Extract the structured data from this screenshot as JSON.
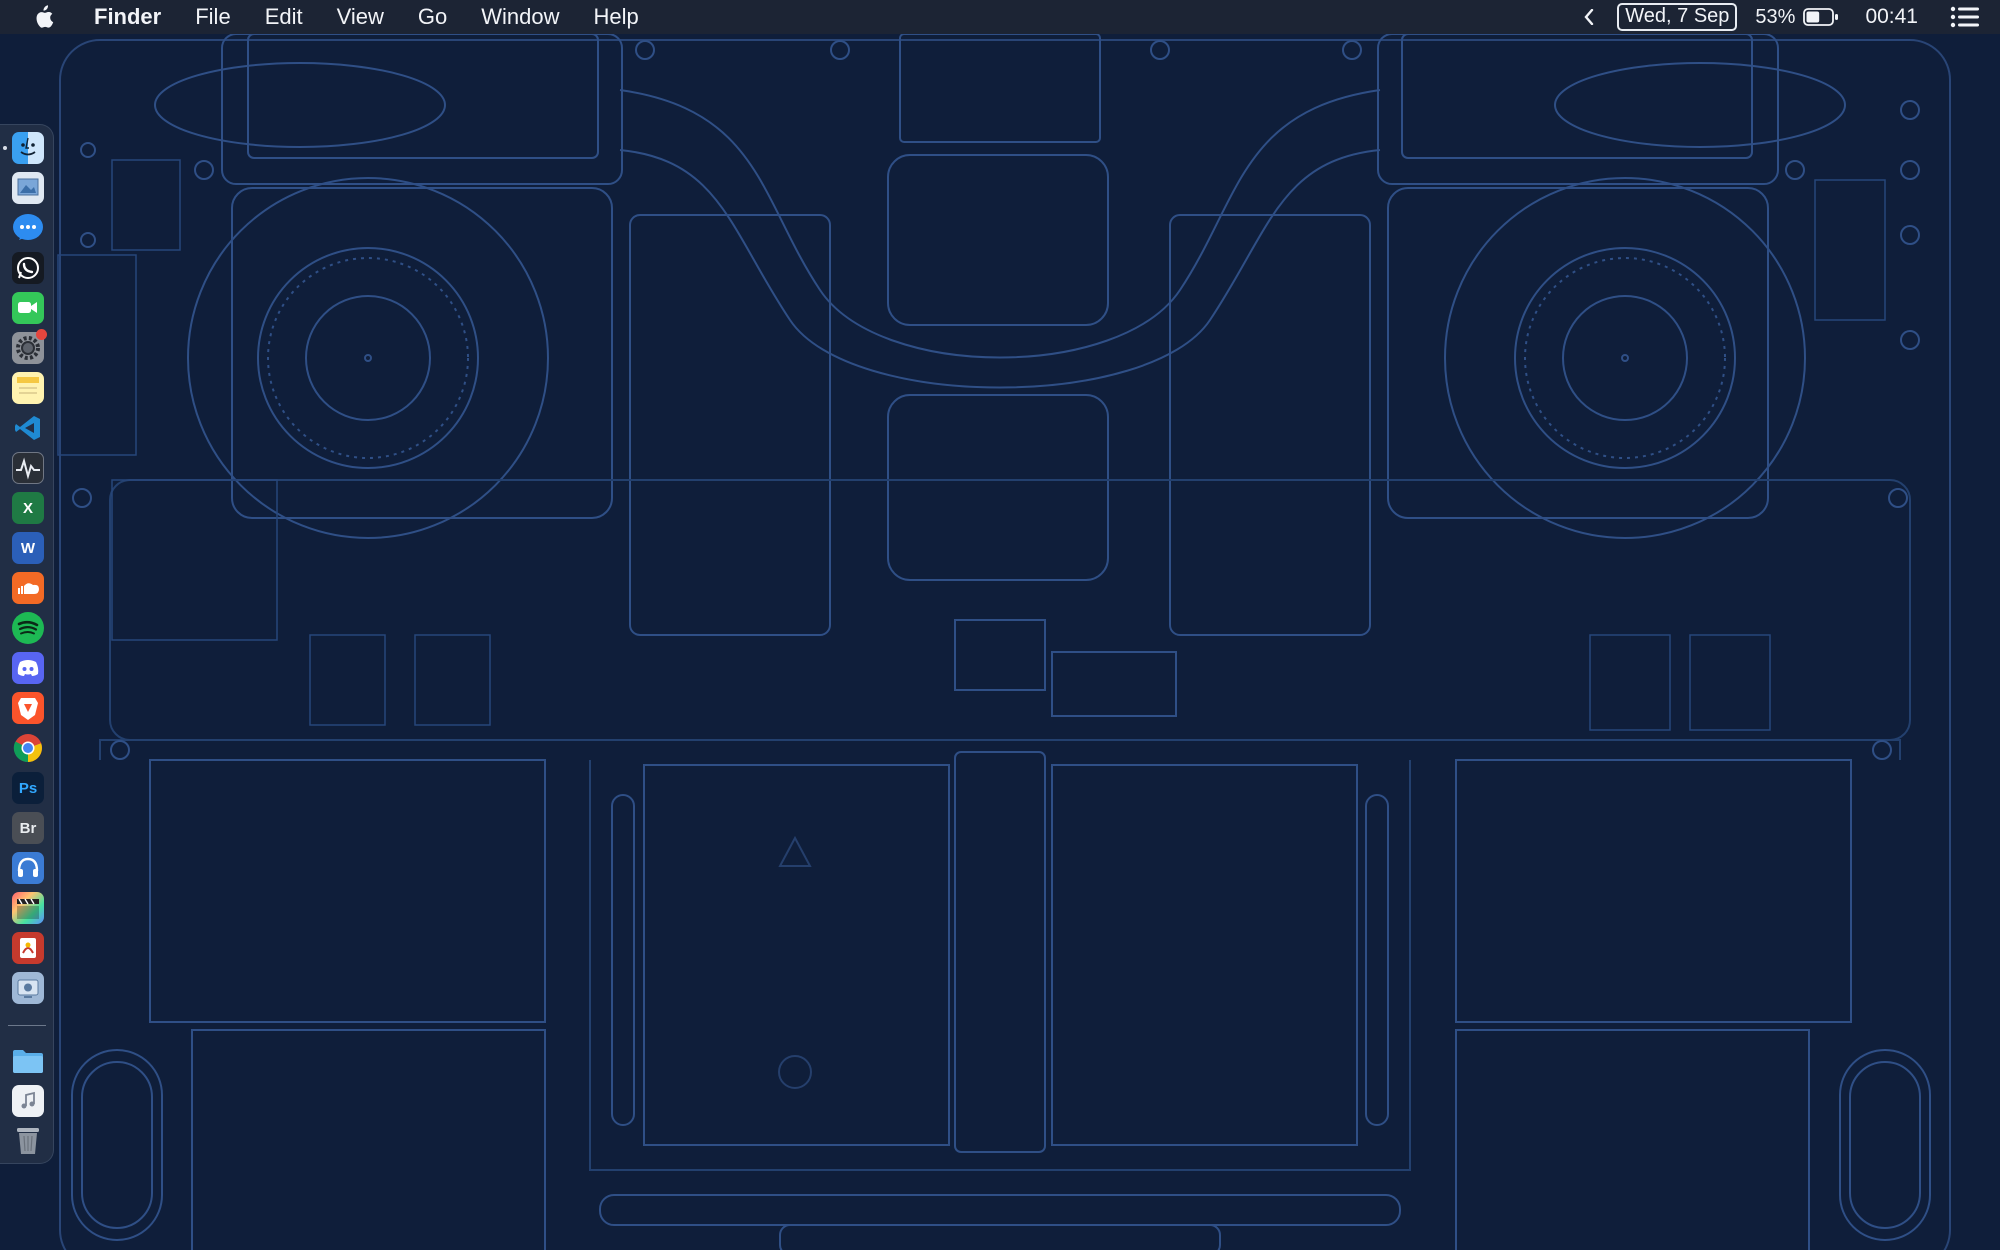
{
  "menubar": {
    "apple_icon": "apple-logo-icon",
    "app_name": "Finder",
    "menus": [
      "File",
      "Edit",
      "View",
      "Go",
      "Window",
      "Help"
    ],
    "date": "Wed, 7 Sep",
    "battery_percent": "53%",
    "battery_level": 0.53,
    "time": "00:41"
  },
  "dock": {
    "items": [
      {
        "name": "finder",
        "icon": "finder-icon",
        "running": true
      },
      {
        "name": "preview",
        "icon": "preview-icon"
      },
      {
        "name": "messenger",
        "icon": "messenger-icon"
      },
      {
        "name": "whatsapp",
        "icon": "whatsapp-icon"
      },
      {
        "name": "facetime",
        "icon": "facetime-icon"
      },
      {
        "name": "system-preferences",
        "icon": "gear-icon",
        "badge": true
      },
      {
        "name": "notes",
        "icon": "notes-icon"
      },
      {
        "name": "vscode",
        "icon": "vscode-icon"
      },
      {
        "name": "activity-monitor",
        "icon": "activity-monitor-icon"
      },
      {
        "name": "excel",
        "icon": "excel-icon",
        "glyph": "X"
      },
      {
        "name": "word",
        "icon": "word-icon",
        "glyph": "W"
      },
      {
        "name": "soundcloud",
        "icon": "soundcloud-icon"
      },
      {
        "name": "spotify",
        "icon": "spotify-icon"
      },
      {
        "name": "discord",
        "icon": "discord-icon"
      },
      {
        "name": "brave",
        "icon": "brave-icon"
      },
      {
        "name": "chrome",
        "icon": "chrome-icon"
      },
      {
        "name": "photoshop",
        "icon": "photoshop-icon",
        "glyph": "Ps"
      },
      {
        "name": "bridge",
        "icon": "bridge-icon",
        "glyph": "Br"
      },
      {
        "name": "audio-app",
        "icon": "audio-app-icon"
      },
      {
        "name": "final-cut",
        "icon": "final-cut-icon"
      },
      {
        "name": "pdf-app",
        "icon": "pdf-app-icon"
      },
      {
        "name": "utility",
        "icon": "utility-icon"
      }
    ],
    "stack_items": [
      {
        "name": "downloads-folder",
        "icon": "folder-icon"
      },
      {
        "name": "music-file",
        "icon": "music-file-icon"
      },
      {
        "name": "trash",
        "icon": "trash-icon"
      }
    ]
  },
  "colors": {
    "wallpaper": "#0f1e3a",
    "line": "#2f4f86",
    "menubar": "#1c2434"
  }
}
